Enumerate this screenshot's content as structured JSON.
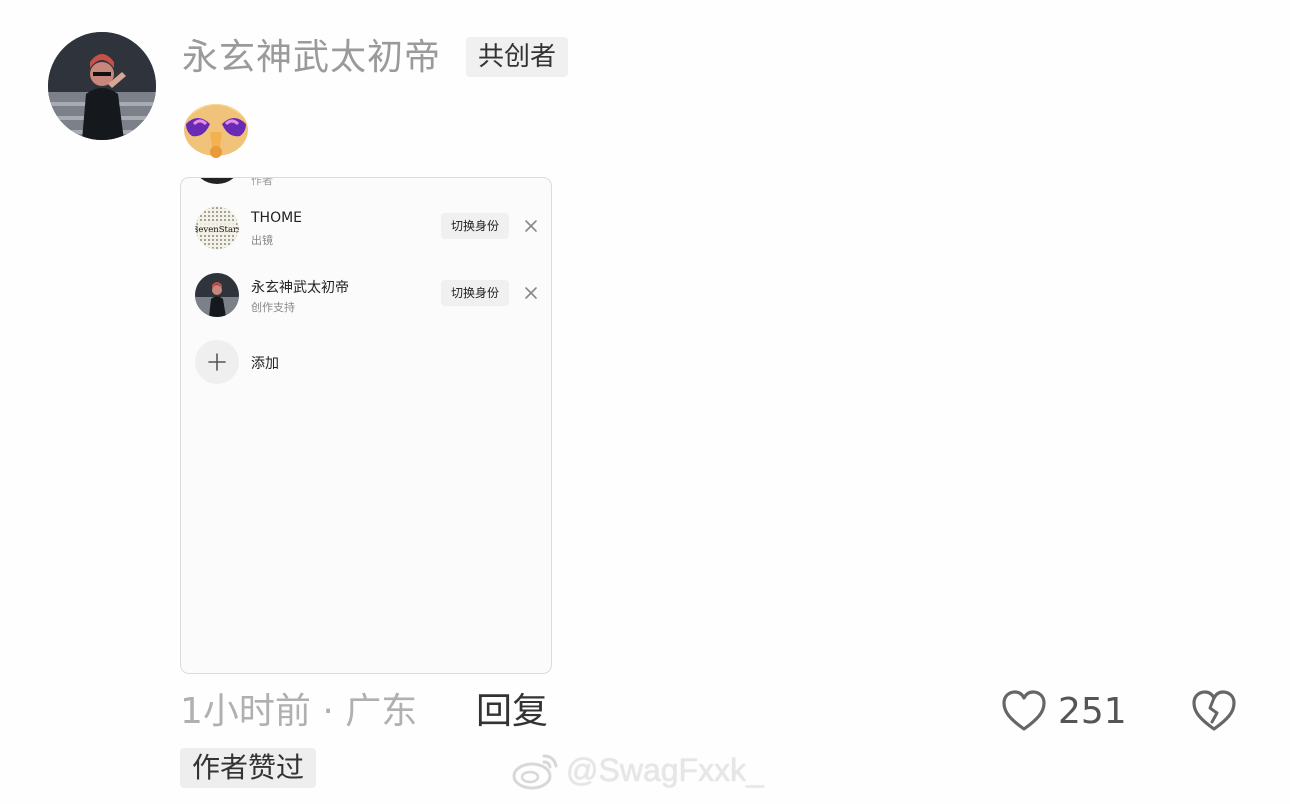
{
  "comment": {
    "username": "永玄神武太初帝",
    "badge": "共创者",
    "meta": {
      "time_location": "1小时前 · 广东",
      "reply_label": "回复",
      "like_count": "251",
      "author_liked": "作者赞过"
    }
  },
  "embedded_screenshot": {
    "cut_off_subtitle": "作者",
    "accounts": [
      {
        "name": "THOME",
        "role": "出镜",
        "switch_label": "切换身份",
        "avatar_text": "SevenStars"
      },
      {
        "name": "永玄神武太初帝",
        "role": "创作支持",
        "switch_label": "切换身份"
      }
    ],
    "add_label": "添加"
  },
  "watermark": {
    "text": "@SwagFxxk_"
  },
  "icons": {
    "close": "close-icon",
    "plus": "plus-icon",
    "like": "heart-outline-icon",
    "dislike": "broken-heart-icon",
    "weibo": "weibo-logo-icon"
  }
}
